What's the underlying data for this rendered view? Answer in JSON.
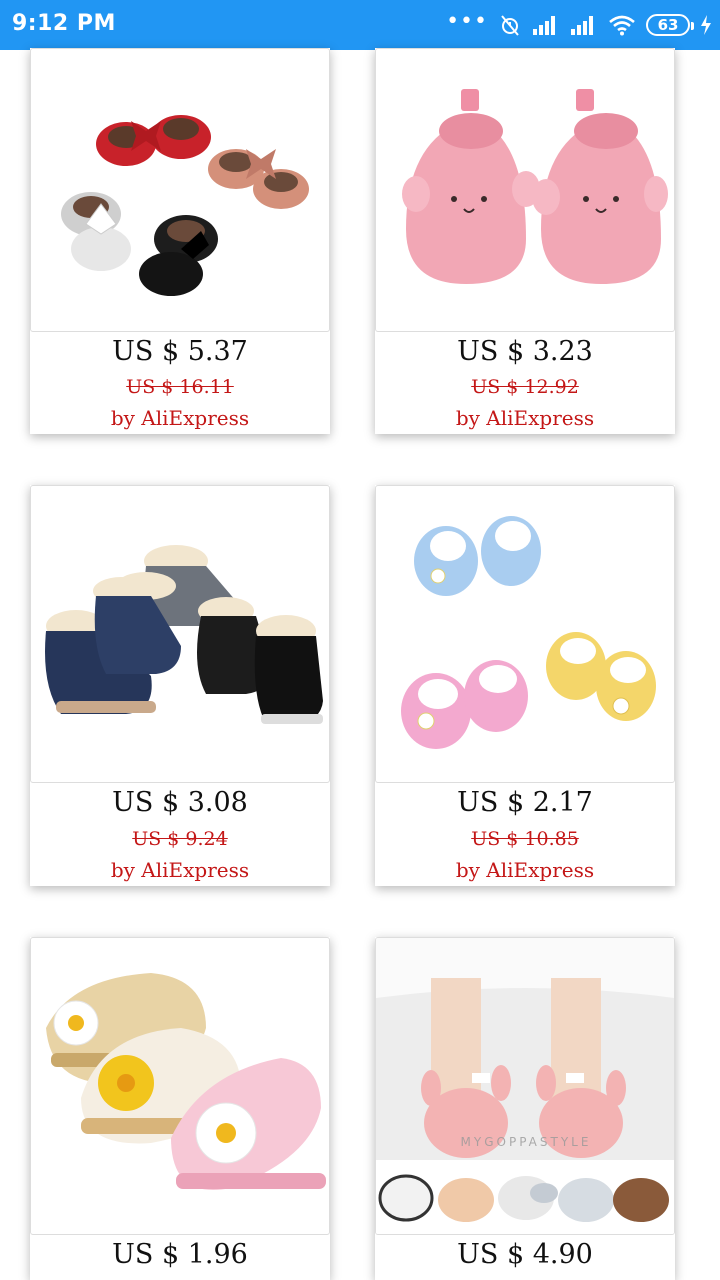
{
  "status_bar": {
    "time": "9:12 PM",
    "battery": "63",
    "icons": [
      "more-dots-icon",
      "alarm-off-icon",
      "signal-1-icon",
      "signal-2-icon",
      "wifi-icon",
      "battery-icon",
      "charging-icon"
    ]
  },
  "products": [
    {
      "price": "US $ 5.37",
      "old_price": "US $ 16.11",
      "seller": "by AliExpress",
      "image": "baby-bow-shoes-image"
    },
    {
      "price": "US $ 3.23",
      "old_price": "US $ 12.92",
      "seller": "by AliExpress",
      "image": "pink-mouse-booties-image"
    },
    {
      "price": "US $ 3.08",
      "old_price": "US $ 9.24",
      "seller": "by AliExpress",
      "image": "lace-up-winter-boots-image"
    },
    {
      "price": "US $ 2.17",
      "old_price": "US $ 10.85",
      "seller": "by AliExpress",
      "image": "flower-plaid-shoes-image"
    },
    {
      "price": "US $ 1.96",
      "image": "daisy-sandals-image"
    },
    {
      "price": "US $ 4.90",
      "image": "bunny-fleece-booties-image",
      "watermark": "MYGOPPASTYLE"
    }
  ]
}
